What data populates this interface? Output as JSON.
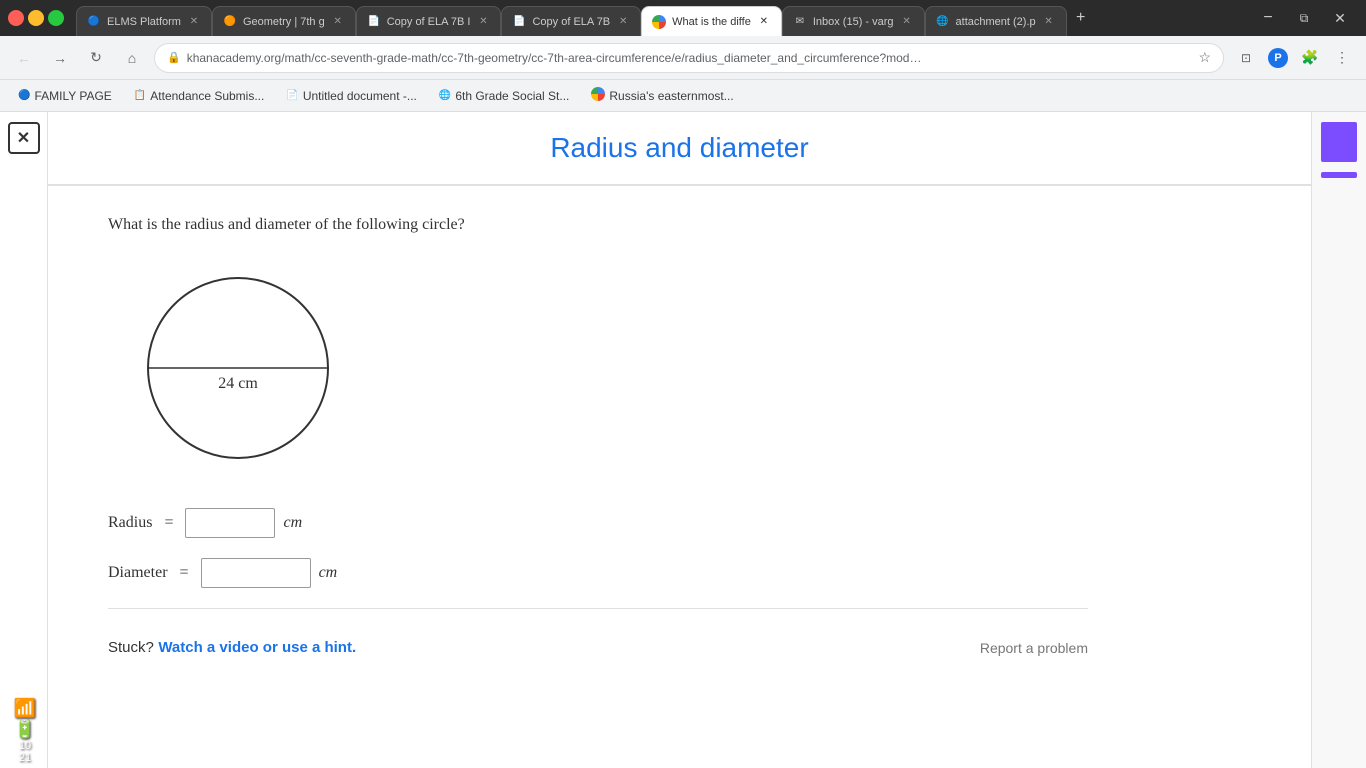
{
  "browser": {
    "tabs": [
      {
        "id": "tab-elms",
        "label": "ELMS Platform",
        "favicon": "🔵",
        "active": false,
        "closeable": true
      },
      {
        "id": "tab-geometry",
        "label": "Geometry | 7th g",
        "favicon": "🟠",
        "active": false,
        "closeable": true
      },
      {
        "id": "tab-ela7b-1",
        "label": "Copy of ELA 7B I",
        "favicon": "📄",
        "active": false,
        "closeable": true
      },
      {
        "id": "tab-ela7b-2",
        "label": "Copy of ELA 7B",
        "favicon": "📄",
        "active": false,
        "closeable": true
      },
      {
        "id": "tab-whatisdiffer",
        "label": "What is the diffe",
        "favicon": "G",
        "active": true,
        "closeable": true
      },
      {
        "id": "tab-inbox",
        "label": "Inbox (15) - varg",
        "favicon": "✉",
        "active": false,
        "closeable": true
      },
      {
        "id": "tab-attachment",
        "label": "attachment (2).p",
        "favicon": "🌐",
        "active": false,
        "closeable": true
      }
    ],
    "url": "khanacademy.org/math/cc-seventh-grade-math/cc-7th-geometry/cc-7th-area-circumference/e/radius_diameter_and_circumference?mod…",
    "url_prefix": "https://",
    "url_domain": "khanacademy.org",
    "url_path": "/math/cc-seventh-grade-math/cc-7th-geometry/cc-7th-area-circumference/e/radius_diameter_and_circumference?mod…"
  },
  "bookmarks": [
    {
      "label": "FAMILY PAGE",
      "favicon": "🔵"
    },
    {
      "label": "Attendance Submis...",
      "favicon": "📋"
    },
    {
      "label": "Untitled document -...",
      "favicon": "📄"
    },
    {
      "label": "6th Grade Social St...",
      "favicon": "🌐"
    },
    {
      "label": "Russia's easternmost...",
      "favicon": "G"
    }
  ],
  "exercise": {
    "title": "Radius and diameter",
    "question": "What is the radius and diameter of the following circle?",
    "circle": {
      "label": "24 cm",
      "description": "Circle with diameter labeled 24 cm"
    },
    "fields": [
      {
        "id": "radius",
        "label": "Radius",
        "equals": "=",
        "unit": "cm",
        "placeholder": ""
      },
      {
        "id": "diameter",
        "label": "Diameter",
        "equals": "=",
        "unit": "cm",
        "placeholder": ""
      }
    ],
    "footer": {
      "stuck_label": "Stuck?",
      "hint_link": "Watch a video or use a hint.",
      "report_label": "Report a problem"
    }
  },
  "system": {
    "wifi_icon": "📶",
    "battery_icon": "🔋",
    "time": "10",
    "date": "21"
  }
}
